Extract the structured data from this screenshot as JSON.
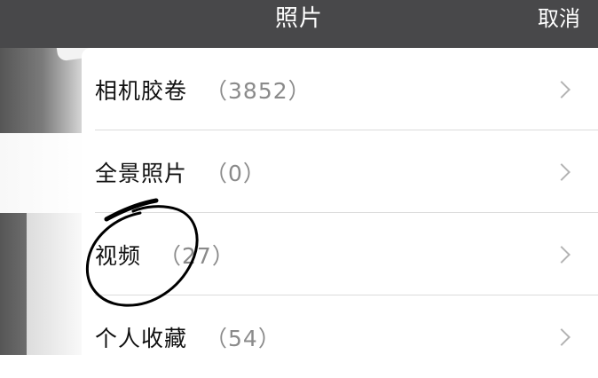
{
  "header": {
    "title": "照片",
    "cancel_label": "取消"
  },
  "albums": [
    {
      "name": "相机胶卷",
      "count": "（3852）"
    },
    {
      "name": "全景照片",
      "count": "（0）"
    },
    {
      "name": "视频",
      "count": "（27）"
    },
    {
      "name": "个人收藏",
      "count": "（54）"
    }
  ],
  "icons": {
    "row_disclosure": "chevron-right-icon"
  },
  "colors": {
    "navbar_background": "#48484a",
    "navbar_text": "#ffffff",
    "list_background": "#ffffff",
    "count_text": "#8a8a8a",
    "annotation_ink": "#000000"
  }
}
